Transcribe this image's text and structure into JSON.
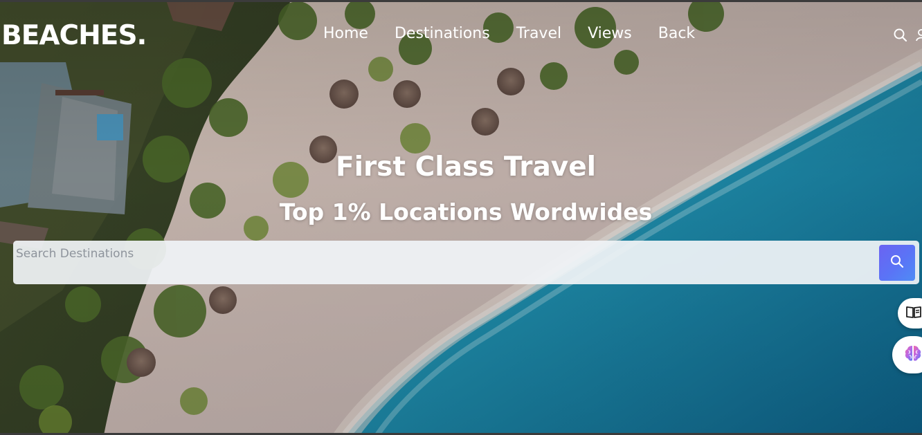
{
  "brand": {
    "logo_text": "BEACHES."
  },
  "nav": {
    "links": [
      {
        "label": "Home"
      },
      {
        "label": "Destinations"
      },
      {
        "label": "Travel"
      },
      {
        "label": "Views"
      },
      {
        "label": "Back"
      }
    ],
    "icons": [
      "search-icon",
      "user-icon"
    ]
  },
  "hero": {
    "title": "First Class Travel",
    "subtitle": "Top 1% Locations Wordwides"
  },
  "search": {
    "placeholder": "Search Destinations",
    "value": "",
    "button_icon": "search-icon"
  },
  "floating_buttons": {
    "icons": [
      "book-icon",
      "brain-icon"
    ]
  },
  "colors": {
    "text_primary": "#ffffff",
    "search_button_gradient_start": "#6b63f2",
    "search_button_gradient_end": "#4f8cf5",
    "search_bar_bg": "#f0f3f6"
  }
}
